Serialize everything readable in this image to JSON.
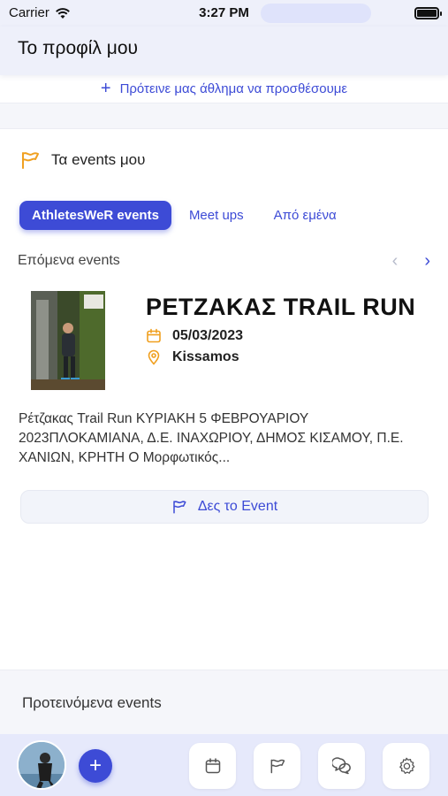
{
  "status_bar": {
    "carrier": "Carrier",
    "time": "3:27 PM",
    "wifi_icon": "wifi-icon",
    "battery_icon": "battery-icon"
  },
  "header": {
    "title": "Το προφίλ μου"
  },
  "suggest": {
    "label": "Πρότεινε μας άθλημα να προσθέσουμε",
    "icon": "plus-icon"
  },
  "my_events": {
    "heading": "Τα events μου",
    "icon": "flag-icon",
    "tabs": [
      {
        "label": "AthletesWeR events",
        "active": true
      },
      {
        "label": "Meet ups",
        "active": false
      },
      {
        "label": "Από εμένα",
        "active": false
      }
    ],
    "upcoming_label": "Επόμενα events",
    "event": {
      "title": "ΡΕΤΖΑΚΑΣ TRAIL RUN",
      "date": "05/03/2023",
      "location": "Kissamos",
      "description": "Ρέτζακας Trail Run ΚΥΡΙΑΚΗ 5 ΦΕΒΡΟΥΑΡΙΟΥ 2023ΠΛΟΚΑΜΙΑΝΑ, Δ.Ε. ΙΝΑΧΩΡΙΟΥ, ΔΗΜΟΣ ΚΙΣΑΜΟΥ, Π.Ε. ΧΑΝΙΩΝ, ΚΡΗΤΗ Ο  Μορφωτικός...",
      "button_label": "Δες το Event"
    }
  },
  "recommended": {
    "label": "Προτεινόμενα events"
  },
  "tab_bar": {
    "add_label": "+",
    "items": [
      "calendar-icon",
      "flag-icon",
      "chat-bubbles-icon",
      "gear-icon"
    ]
  },
  "colors": {
    "accent": "#3d4bd6",
    "icon_orange": "#f0a020",
    "header_bg": "#eef0fa",
    "tabbar_bg": "#e6e9fb"
  }
}
